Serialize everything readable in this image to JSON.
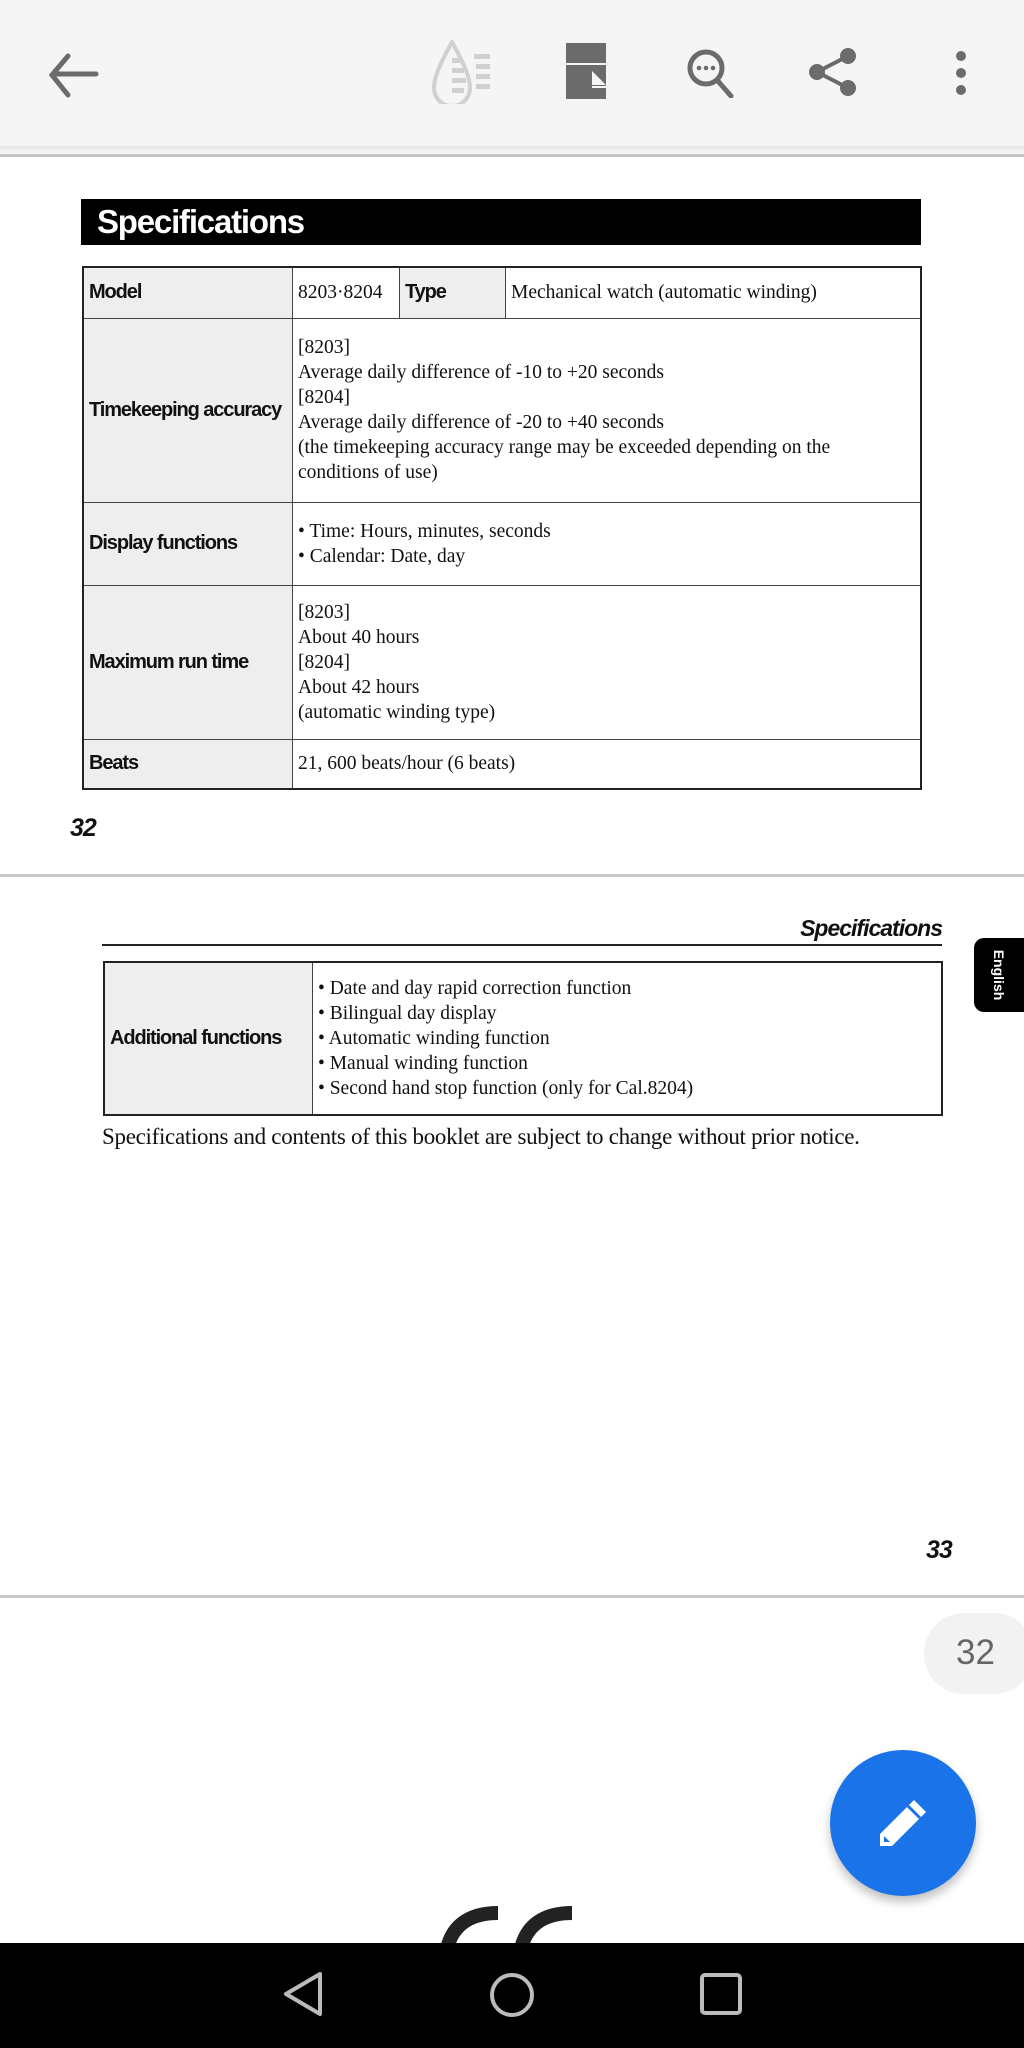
{
  "toolbar": {
    "icons": [
      "back-arrow-icon",
      "reading-mode-icon",
      "page-layout-icon",
      "search-icon",
      "share-icon",
      "more-vert-icon"
    ]
  },
  "page32": {
    "heading": "Specifications",
    "rows": [
      {
        "label": "Model",
        "value": "8203·8204",
        "label2": "Type",
        "value2": "Mechanical watch (automatic winding)"
      },
      {
        "label": "Timekeeping accuracy",
        "lines": [
          "[8203]",
          "Average daily difference of -10 to +20 seconds",
          "[8204]",
          "Average daily difference of -20 to +40 seconds",
          "(the timekeeping accuracy range may be exceeded depending on the",
          "conditions of use)"
        ]
      },
      {
        "label": "Display functions",
        "lines": [
          "• Time: Hours, minutes, seconds",
          "• Calendar: Date, day"
        ]
      },
      {
        "label": "Maximum run time",
        "lines": [
          "[8203]",
          "About 40 hours",
          "[8204]",
          "About 42 hours",
          "(automatic winding type)"
        ]
      },
      {
        "label": "Beats",
        "lines": [
          "21, 600 beats/hour (6 beats)"
        ]
      }
    ],
    "page_number": "32"
  },
  "page33": {
    "running_header": "Specifications",
    "language_tab": "English",
    "row": {
      "label": "Additional functions",
      "lines": [
        "• Date and day rapid correction function",
        "• Bilingual day display",
        "• Automatic winding function",
        "• Manual winding function",
        "• Second hand stop function (only for Cal.8204)"
      ]
    },
    "notice": "Specifications and contents of this booklet are subject to change without prior notice.",
    "page_number": "33"
  },
  "page_indicator": "32",
  "fab": {
    "icon": "pencil-icon",
    "color": "#1a73e8"
  },
  "navbar": {
    "icons": [
      "nav-back-icon",
      "nav-home-icon",
      "nav-recents-icon"
    ]
  }
}
